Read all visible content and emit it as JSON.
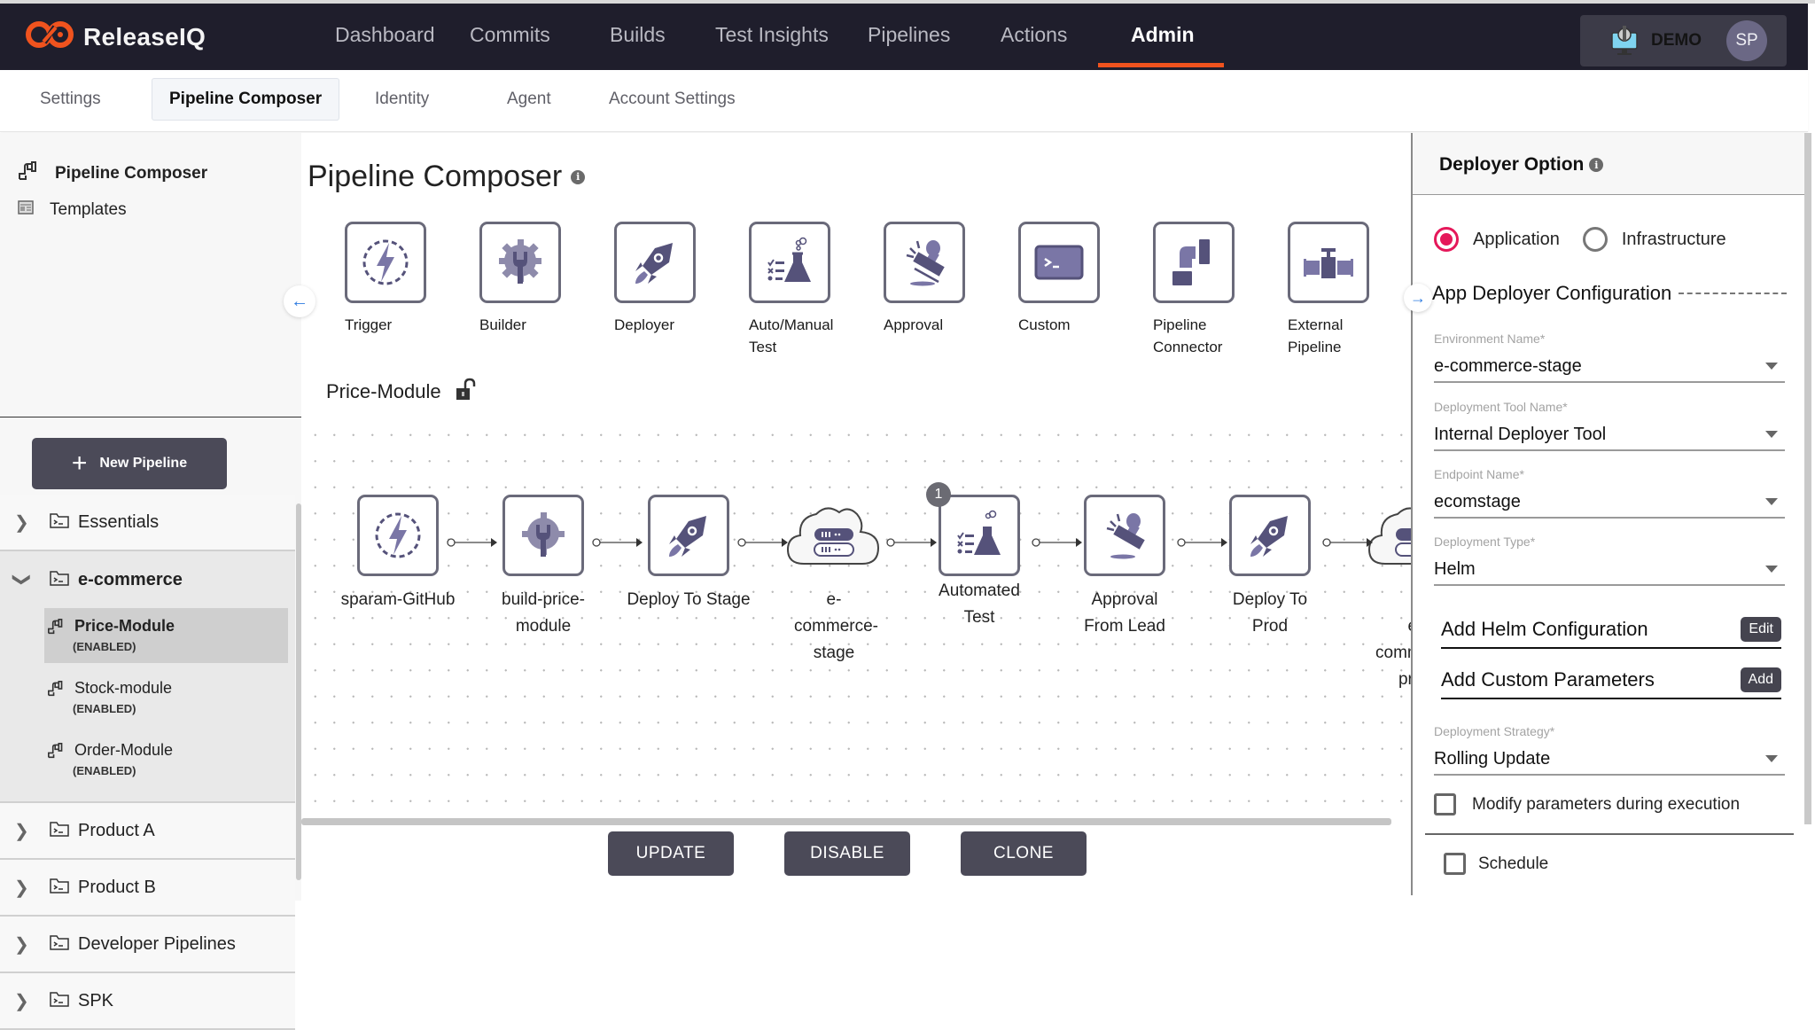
{
  "app": {
    "brand": "ReleaseIQ",
    "brand_color": "#f0531e",
    "header_bg": "#1f1e2c"
  },
  "header": {
    "nav": [
      {
        "label": "Dashboard",
        "active": false
      },
      {
        "label": "Commits",
        "active": false
      },
      {
        "label": "Builds",
        "active": false
      },
      {
        "label": "Test Insights",
        "active": false
      },
      {
        "label": "Pipelines",
        "active": false
      },
      {
        "label": "Actions",
        "active": false
      },
      {
        "label": "Admin",
        "active": true
      }
    ],
    "org_label": "DEMO",
    "avatar_initials": "SP"
  },
  "subnav": {
    "tabs": [
      {
        "label": "Settings",
        "active": false
      },
      {
        "label": "Pipeline Composer",
        "active": true
      },
      {
        "label": "Identity",
        "active": false
      },
      {
        "label": "Agent",
        "active": false
      },
      {
        "label": "Account Settings",
        "active": false
      }
    ]
  },
  "sidebar": {
    "top_items": [
      {
        "label": "Pipeline Composer",
        "icon": "pipe-icon",
        "active": true
      },
      {
        "label": "Templates",
        "icon": "template-icon",
        "active": false
      }
    ],
    "new_pipeline_label": "New Pipeline",
    "folders": [
      {
        "label": "Essentials",
        "expanded": false
      },
      {
        "label": "e-commerce",
        "expanded": true,
        "children": [
          {
            "name": "Price-Module",
            "status": "(ENABLED)",
            "selected": true
          },
          {
            "name": "Stock-module",
            "status": "(ENABLED)",
            "selected": false
          },
          {
            "name": "Order-Module",
            "status": "(ENABLED)",
            "selected": false
          }
        ]
      },
      {
        "label": "Product A",
        "expanded": false
      },
      {
        "label": "Product B",
        "expanded": false
      },
      {
        "label": "Developer Pipelines",
        "expanded": false
      },
      {
        "label": "SPK",
        "expanded": false
      }
    ]
  },
  "main": {
    "title": "Pipeline Composer",
    "info_icon": "i",
    "palette": [
      {
        "label": "Trigger",
        "icon": "trigger-icon"
      },
      {
        "label": "Builder",
        "icon": "builder-icon"
      },
      {
        "label": "Deployer",
        "icon": "deployer-icon"
      },
      {
        "label": "Auto/Manual Test",
        "icon": "test-icon"
      },
      {
        "label": "Approval",
        "icon": "approval-icon"
      },
      {
        "label": "Custom",
        "icon": "custom-icon"
      },
      {
        "label": "Pipeline Connector",
        "icon": "connector-icon"
      },
      {
        "label": "External Pipeline",
        "icon": "external-pipeline-icon"
      }
    ],
    "pipeline_name": "Price-Module",
    "lock_state": "unlocked",
    "nodes": [
      {
        "label": "sparam-GitHub",
        "type": "trigger"
      },
      {
        "label": "build-price-module",
        "type": "builder"
      },
      {
        "label": "Deploy To Stage",
        "type": "deployer"
      },
      {
        "label": "e-commerce-stage",
        "type": "environment"
      },
      {
        "label": "Automated Test",
        "type": "test",
        "badge": "1"
      },
      {
        "label": "Approval From Lead",
        "type": "approval"
      },
      {
        "label": "Deploy To Prod",
        "type": "deployer"
      },
      {
        "label": "e-commerce-prod",
        "type": "environment"
      }
    ],
    "actions": {
      "update": "UPDATE",
      "disable": "DISABLE",
      "clone": "CLONE"
    }
  },
  "deployer_panel": {
    "title": "Deployer Option",
    "deploy_target": {
      "options": [
        "Application",
        "Infrastructure"
      ],
      "selected": "Application"
    },
    "section_title": "App Deployer Configuration",
    "fields": [
      {
        "label": "Environment Name*",
        "value": "e-commerce-stage"
      },
      {
        "label": "Deployment Tool Name*",
        "value": "Internal Deployer Tool"
      },
      {
        "label": "Endpoint Name*",
        "value": "ecomstage"
      },
      {
        "label": "Deployment Type*",
        "value": "Helm"
      }
    ],
    "helm_config": {
      "label": "Add Helm Configuration",
      "button": "Edit"
    },
    "custom_params": {
      "label": "Add Custom Parameters",
      "button": "Add"
    },
    "strategy": {
      "label": "Deployment Strategy*",
      "value": "Rolling Update"
    },
    "modify_params": {
      "label": "Modify parameters during execution",
      "checked": false
    },
    "schedule": {
      "label": "Schedule",
      "checked": false
    },
    "accent_color": "#e5185a"
  }
}
